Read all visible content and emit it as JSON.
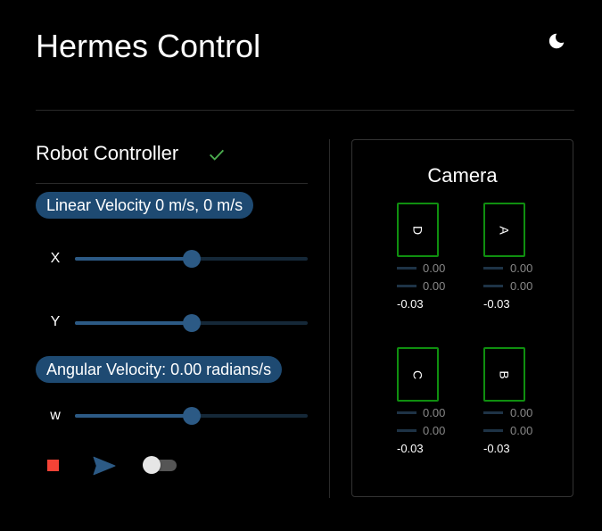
{
  "header": {
    "title": "Hermes Control",
    "theme_icon": "moon-icon"
  },
  "controller": {
    "title": "Robot Controller",
    "status_icon": "check-icon",
    "status_color": "#4caf50",
    "linear_label": "Linear Velocity 0 m/s, 0 m/s",
    "angular_label": "Angular Velocity: 0.00 radians/s",
    "sliders": [
      {
        "label": "X",
        "value": 0.5
      },
      {
        "label": "Y",
        "value": 0.5
      },
      {
        "label": "w",
        "value": 0.5
      }
    ],
    "stop_color": "#f44336",
    "toggle_on": false
  },
  "camera": {
    "title": "Camera",
    "wheels": [
      {
        "label": "D",
        "val1": "0.00",
        "val2": "0.00",
        "val3": "-0.03"
      },
      {
        "label": "A",
        "val1": "0.00",
        "val2": "0.00",
        "val3": "-0.03"
      },
      {
        "label": "C",
        "val1": "0.00",
        "val2": "0.00",
        "val3": "-0.03"
      },
      {
        "label": "B",
        "val1": "0.00",
        "val2": "0.00",
        "val3": "-0.03"
      }
    ],
    "wheel_border_color": "#0f8f0f"
  }
}
